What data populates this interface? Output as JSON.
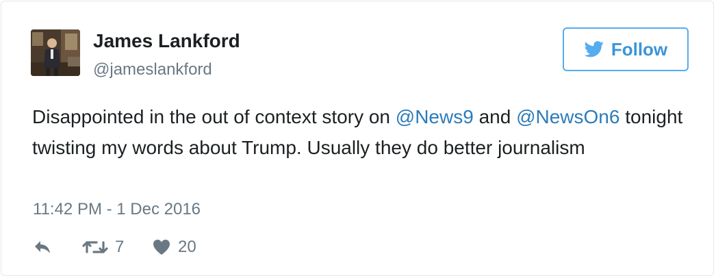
{
  "author": {
    "name": "James Lankford",
    "handle": "@jameslankford"
  },
  "follow_button": {
    "label": "Follow",
    "icon": "twitter-bird-icon",
    "color": "#55acee"
  },
  "tweet": {
    "segments": [
      {
        "text": "Disappointed in the out of context story on "
      },
      {
        "text": "@News9",
        "mention": true
      },
      {
        "text": " and "
      },
      {
        "text": "@NewsOn6",
        "mention": true
      },
      {
        "text": " tonight twisting my words about Trump. Usually they do better journalism"
      }
    ],
    "timestamp": "11:42 PM - 1 Dec 2016"
  },
  "actions": {
    "reply": {
      "icon": "reply-icon"
    },
    "retweet": {
      "icon": "retweet-icon",
      "count": "7"
    },
    "like": {
      "icon": "heart-icon",
      "count": "20"
    }
  },
  "colors": {
    "text": "#1c2022",
    "muted": "#697882",
    "link": "#2b7bb9",
    "border": "#e1e8ed"
  }
}
